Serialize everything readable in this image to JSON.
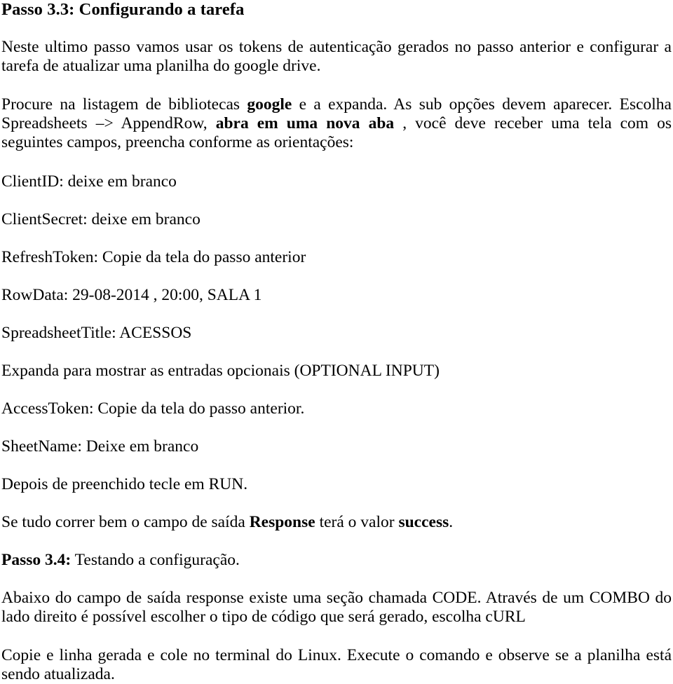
{
  "document": {
    "heading": "Passo 3.3: Configurando a tarefa",
    "intro_paragraph": "Neste ultimo passo vamos usar os tokens de autenticação gerados no passo anterior e configurar a tarefa de atualizar uma planilha do google drive.",
    "instruction_paragraph": {
      "part1": "Procure na listagem de bibliotecas ",
      "bold1": "google",
      "part2": " e a expanda. As sub opções devem aparecer. Escolha Spreadsheets  –> AppendRow, ",
      "bold2": "abra em uma nova aba",
      "part3": " , você deve receber uma tela com os seguintes campos, preencha conforme as orientações:"
    },
    "fields": [
      {
        "label": "ClientID:",
        "value": "deixe em branco",
        "text": "ClientID: deixe em branco"
      },
      {
        "label": "ClientSecret:",
        "value": "deixe em branco",
        "text": "ClientSecret: deixe em branco"
      },
      {
        "label": "RefreshToken:",
        "value": "Copie da tela do passo anterior",
        "text": "RefreshToken: Copie da tela do passo anterior"
      },
      {
        "label": "RowData:",
        "value": "29-08-2014 , 20:00, SALA 1",
        "text": "RowData: 29-08-2014 , 20:00, SALA 1"
      },
      {
        "label": "SpreadsheetTitle:",
        "value": "ACESSOS",
        "text": "SpreadsheetTitle: ACESSOS"
      }
    ],
    "optional_note": "Expanda para mostrar as entradas opcionais (OPTIONAL INPUT)",
    "optional_fields": [
      {
        "label": "AccessToken:",
        "value": "Copie da tela do passo anterior.",
        "text": "AccessToken: Copie da tela do passo anterior."
      },
      {
        "label": "SheetName:",
        "value": "Deixe em branco",
        "text": "SheetName: Deixe em branco"
      }
    ],
    "run_note": "Depois de preenchido tecle em RUN.",
    "success_line": {
      "part1": "Se tudo correr bem o campo de saída ",
      "bold1": "Response",
      "part2": " terá o valor ",
      "bold2": "success",
      "part3": "."
    },
    "subheading_2": {
      "bold": "Passo 3.4:",
      "rest": " Testando a configuração."
    },
    "code_paragraph": "Abaixo do campo de saída response existe uma seção chamada CODE. Através de um COMBO do lado direito é possível escolher o tipo de código que será gerado, escolha cURL",
    "final_paragraph": "Copie e linha gerada e cole no terminal do Linux. Execute o comando e observe se a planilha está sendo atualizada."
  }
}
